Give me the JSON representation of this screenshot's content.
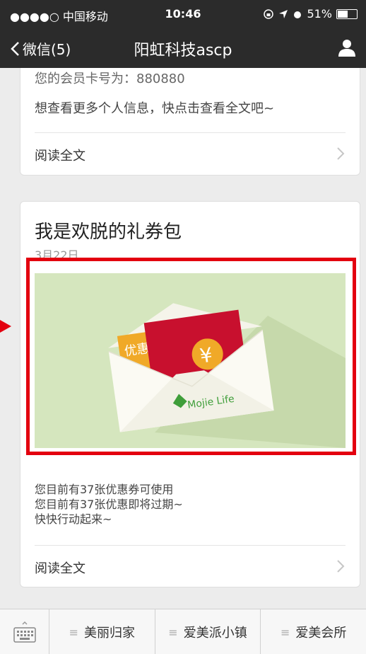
{
  "status": {
    "carrier": "●●●●○ 中国移动",
    "time": "10:46",
    "battery": "51%",
    "battery_level": 0.51
  },
  "nav": {
    "back_label": "微信(5)",
    "title": "阳虹科技ascp"
  },
  "card1": {
    "member_line": "您的会员卡号为：880880",
    "more_line": "想查看更多个人信息，快点击查看全文吧~",
    "read_more": "阅读全文"
  },
  "card2": {
    "title": "我是欢脱的礼券包",
    "date": "3月22日",
    "desc_lines": [
      "您目前有37张优惠券可使用",
      "您目前有37张优惠即将过期~",
      "快快行动起来~"
    ],
    "read_more": "阅读全文",
    "image": {
      "coupon_text": "优惠",
      "yen": "¥",
      "brand": "Mojie Life"
    }
  },
  "bottom_menu": [
    "美丽归家",
    "爱美派小镇",
    "爱美会所"
  ],
  "colors": {
    "header": "#2b2b2b",
    "highlight": "#e3000f",
    "image_bg": "#d5e6be"
  }
}
